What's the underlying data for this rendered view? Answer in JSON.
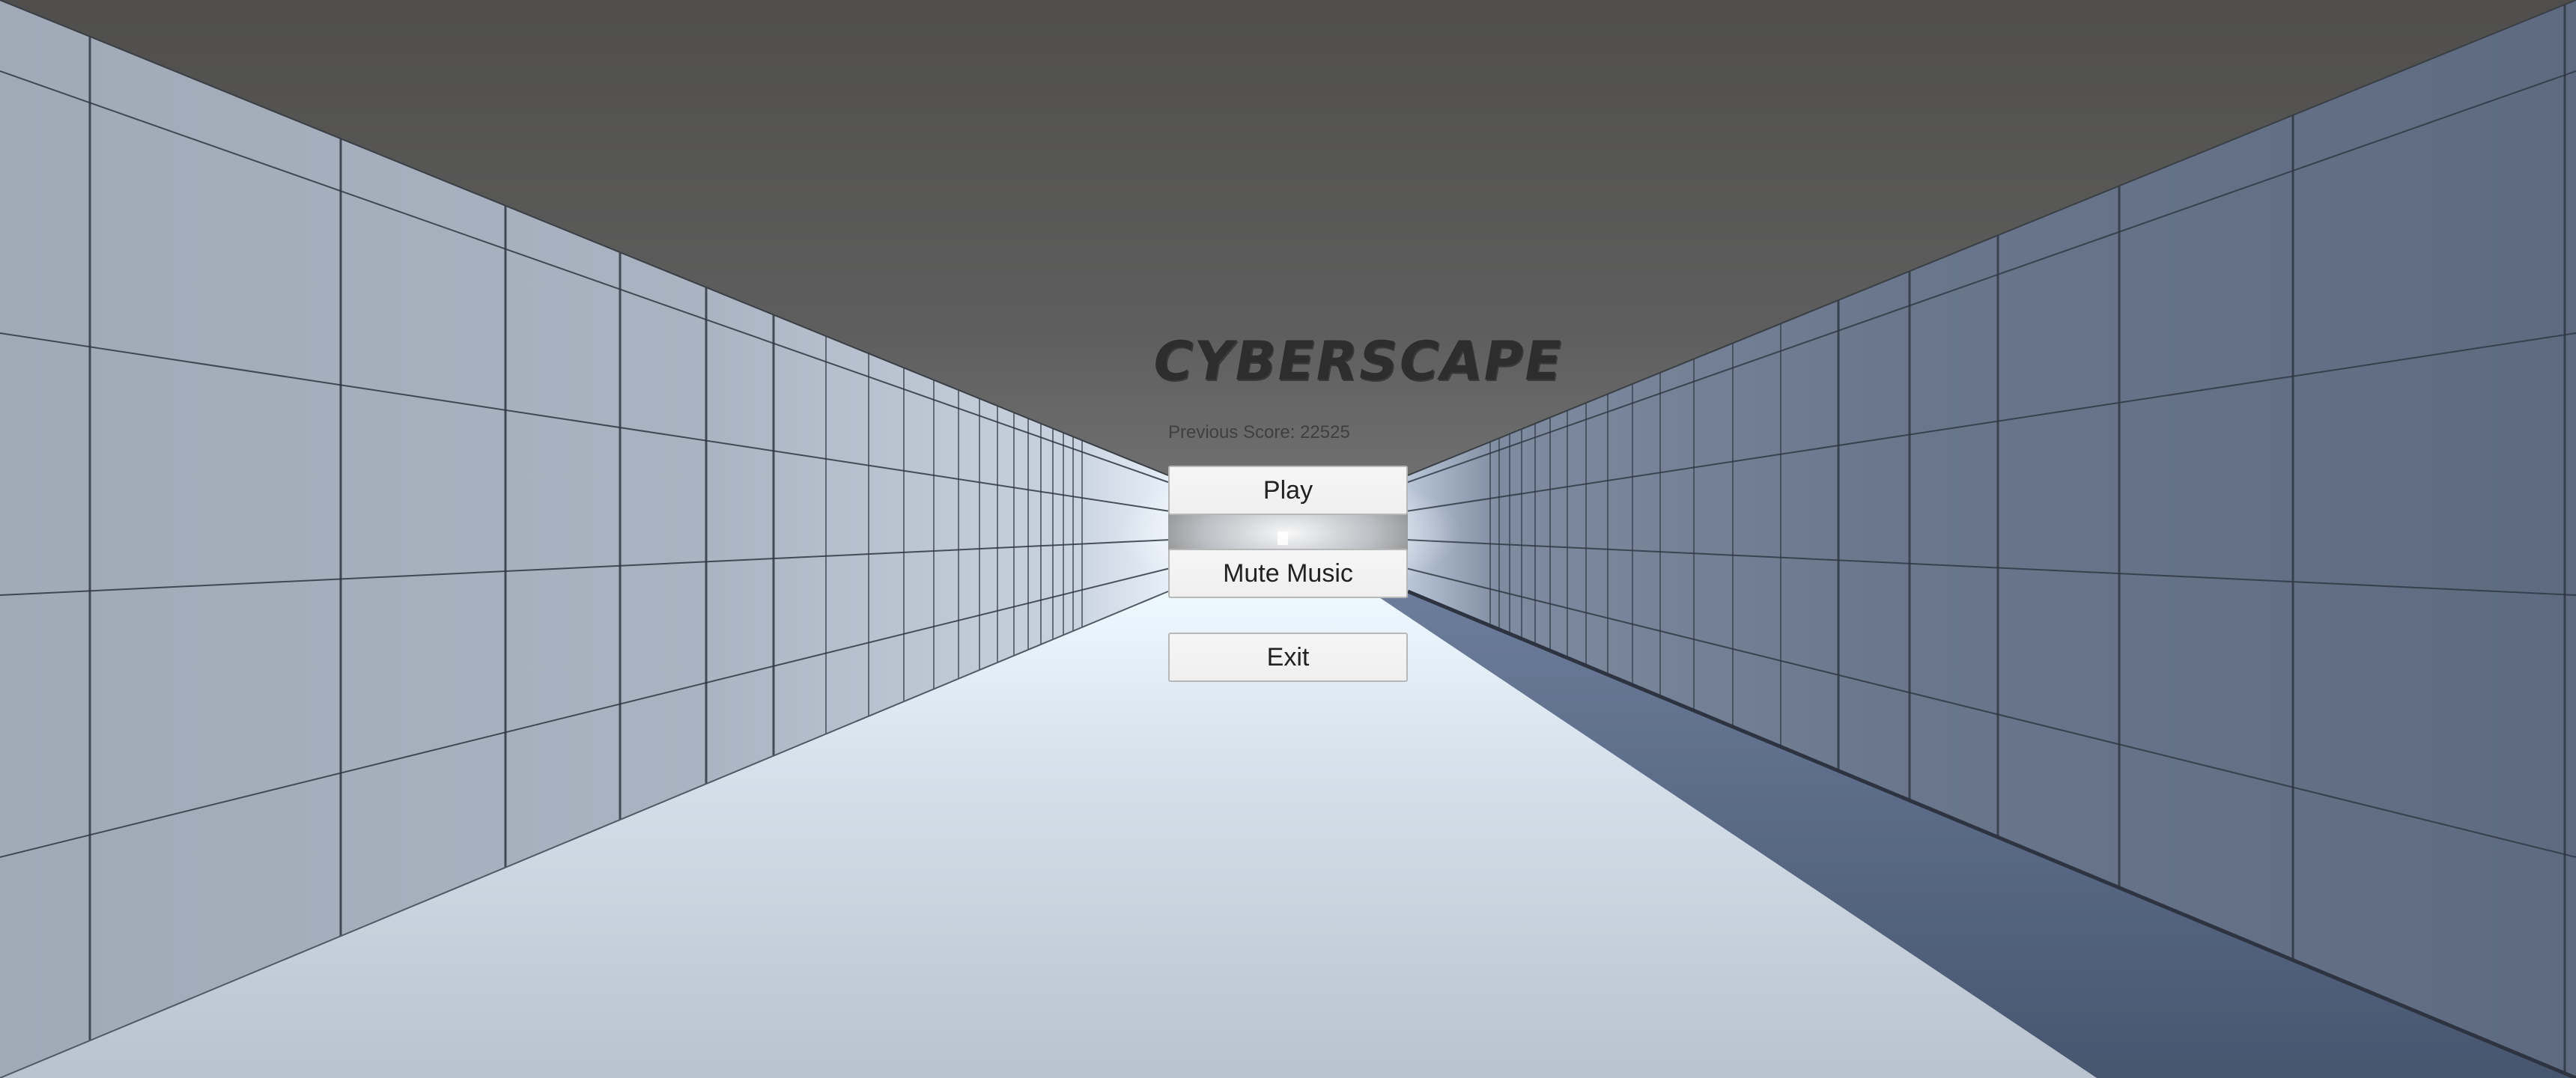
{
  "game": {
    "title": "CYBERSCAPE"
  },
  "menu": {
    "previous_score_label": "Previous Score:",
    "previous_score_value": "22525",
    "play_label": "Play",
    "mute_label": "Mute Music",
    "exit_label": "Exit"
  },
  "colors": {
    "ceiling": "#565656",
    "left_wall": "#a3adbb",
    "right_wall": "#5f6e85",
    "floor": "#c9d3df",
    "title_text": "#2d2d2d",
    "button_bg": "#f4f4f4"
  }
}
